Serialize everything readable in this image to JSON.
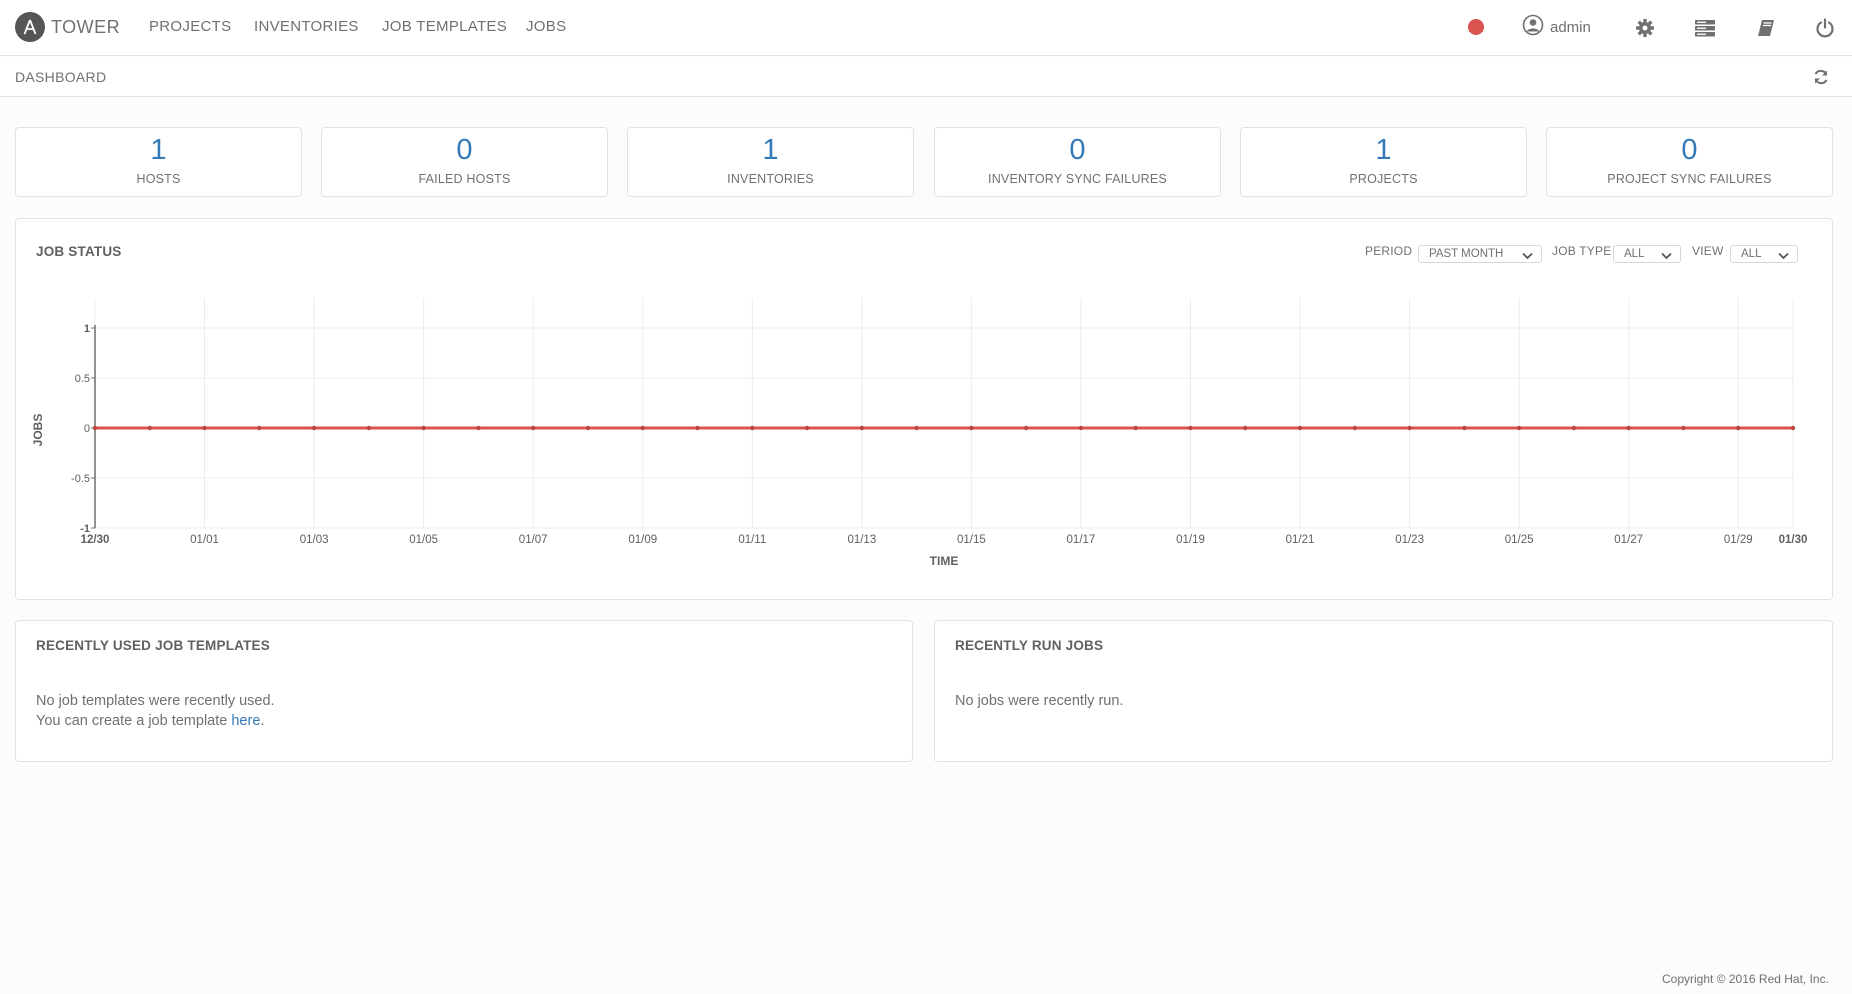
{
  "nav": {
    "brand": "TOWER",
    "links": [
      "PROJECTS",
      "INVENTORIES",
      "JOB TEMPLATES",
      "JOBS"
    ],
    "user": "admin",
    "status_color": "#d9534f"
  },
  "breadcrumb": "DASHBOARD",
  "counts": [
    {
      "value": "1",
      "label": "HOSTS"
    },
    {
      "value": "0",
      "label": "FAILED HOSTS"
    },
    {
      "value": "1",
      "label": "INVENTORIES"
    },
    {
      "value": "0",
      "label": "INVENTORY SYNC FAILURES"
    },
    {
      "value": "1",
      "label": "PROJECTS"
    },
    {
      "value": "0",
      "label": "PROJECT SYNC FAILURES"
    }
  ],
  "job_status": {
    "title": "JOB STATUS",
    "period_label": "PERIOD",
    "period_value": "PAST MONTH",
    "job_type_label": "JOB TYPE",
    "job_type_value": "ALL",
    "view_label": "VIEW",
    "view_value": "ALL"
  },
  "chart_data": {
    "type": "line",
    "xlabel": "TIME",
    "ylabel": "JOBS",
    "ylim": [
      -1,
      1
    ],
    "yticks": [
      "1",
      "0.5",
      "0",
      "-0.5",
      "-1"
    ],
    "xticks": [
      "12/30",
      "01/01",
      "01/03",
      "01/05",
      "01/07",
      "01/09",
      "01/11",
      "01/13",
      "01/15",
      "01/17",
      "01/19",
      "01/21",
      "01/23",
      "01/25",
      "01/27",
      "01/29",
      "01/30"
    ],
    "x": [
      "12/30",
      "12/31",
      "01/01",
      "01/02",
      "01/03",
      "01/04",
      "01/05",
      "01/06",
      "01/07",
      "01/08",
      "01/09",
      "01/10",
      "01/11",
      "01/12",
      "01/13",
      "01/14",
      "01/15",
      "01/16",
      "01/17",
      "01/18",
      "01/19",
      "01/20",
      "01/21",
      "01/22",
      "01/23",
      "01/24",
      "01/25",
      "01/26",
      "01/27",
      "01/28",
      "01/29",
      "01/30"
    ],
    "series": [
      {
        "color": "#d9534f",
        "values": [
          0,
          0,
          0,
          0,
          0,
          0,
          0,
          0,
          0,
          0,
          0,
          0,
          0,
          0,
          0,
          0,
          0,
          0,
          0,
          0,
          0,
          0,
          0,
          0,
          0,
          0,
          0,
          0,
          0,
          0,
          0,
          0
        ]
      }
    ],
    "grid": true
  },
  "recent_templates": {
    "title": "RECENTLY USED JOB TEMPLATES",
    "line1": "No job templates were recently used.",
    "line2": "You can create a job template",
    "link": "here",
    "period": "."
  },
  "recent_jobs": {
    "title": "RECENTLY RUN JOBS",
    "text": "No jobs were recently run."
  },
  "copyright": "Copyright © 2016 Red Hat, Inc."
}
